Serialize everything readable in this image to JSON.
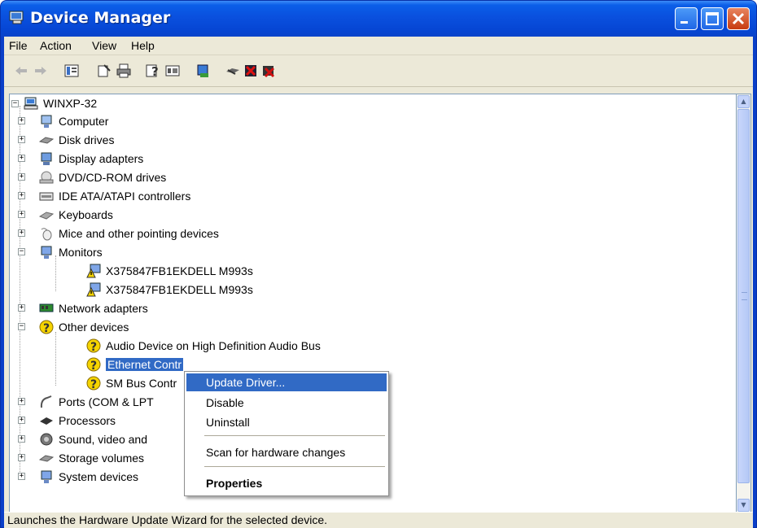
{
  "window": {
    "title": "Device Manager"
  },
  "menu": [
    "File",
    "Action",
    "View",
    "Help"
  ],
  "toolbar": [
    "back-icon",
    "forward-icon",
    "show-hide-console-tree-icon",
    "properties-icon",
    "print-icon",
    "help-icon",
    "view-icon",
    "scan-hardware-icon",
    "update-driver-icon",
    "disable-device-icon",
    "uninstall-device-icon"
  ],
  "tree": {
    "root": "WINXP-32",
    "items": [
      {
        "label": "Computer",
        "icon": "computer-icon",
        "expander": "+"
      },
      {
        "label": "Disk drives",
        "icon": "disk-drive-icon",
        "expander": "+"
      },
      {
        "label": "Display adapters",
        "icon": "display-adapter-icon",
        "expander": "+"
      },
      {
        "label": "DVD/CD-ROM drives",
        "icon": "dvd-drive-icon",
        "expander": "+"
      },
      {
        "label": "IDE ATA/ATAPI controllers",
        "icon": "ide-controller-icon",
        "expander": "+"
      },
      {
        "label": "Keyboards",
        "icon": "keyboard-icon",
        "expander": "+"
      },
      {
        "label": "Mice and other pointing devices",
        "icon": "mouse-icon",
        "expander": "+"
      },
      {
        "label": "Monitors",
        "icon": "monitor-icon",
        "expander": "−"
      },
      {
        "label": "X375847FB1EKDELL M993s",
        "icon": "warning-monitor-icon",
        "child": true
      },
      {
        "label": "X375847FB1EKDELL M993s",
        "icon": "warning-monitor-icon",
        "child": true
      },
      {
        "label": "Network adapters",
        "icon": "network-adapter-icon",
        "expander": "+"
      },
      {
        "label": "Other devices",
        "icon": "unknown-device-icon",
        "expander": "−"
      },
      {
        "label": "Audio Device on High Definition Audio Bus",
        "icon": "unknown-device-icon",
        "child": true
      },
      {
        "label": "Ethernet Controller",
        "icon": "unknown-device-icon",
        "child": true,
        "selected": true
      },
      {
        "label": "SM Bus Controller",
        "icon": "unknown-device-icon",
        "child": true
      },
      {
        "label": "Ports (COM & LPT)",
        "icon": "port-icon",
        "expander": "+"
      },
      {
        "label": "Processors",
        "icon": "processor-icon",
        "expander": "+"
      },
      {
        "label": "Sound, video and game controllers",
        "icon": "sound-icon",
        "expander": "+"
      },
      {
        "label": "Storage volumes",
        "icon": "storage-volume-icon",
        "expander": "+"
      },
      {
        "label": "System devices",
        "icon": "system-device-icon",
        "expander": "+"
      }
    ],
    "visible_labels": {
      "ethernet": "Ethernet Contr",
      "smbus": "SM Bus Contr",
      "ports": "Ports (COM & LPT",
      "sound": "Sound, video and"
    }
  },
  "context_menu": {
    "items": [
      "Update Driver...",
      "Disable",
      "Uninstall",
      "Scan for hardware changes",
      "Properties"
    ]
  },
  "status_bar": {
    "text": "Launches the Hardware Update Wizard for the selected device."
  },
  "colors": {
    "title_blue": "#0a50de",
    "selection": "#316ac5",
    "close_red": "#c73b10",
    "warning_yellow": "#f5d400"
  }
}
